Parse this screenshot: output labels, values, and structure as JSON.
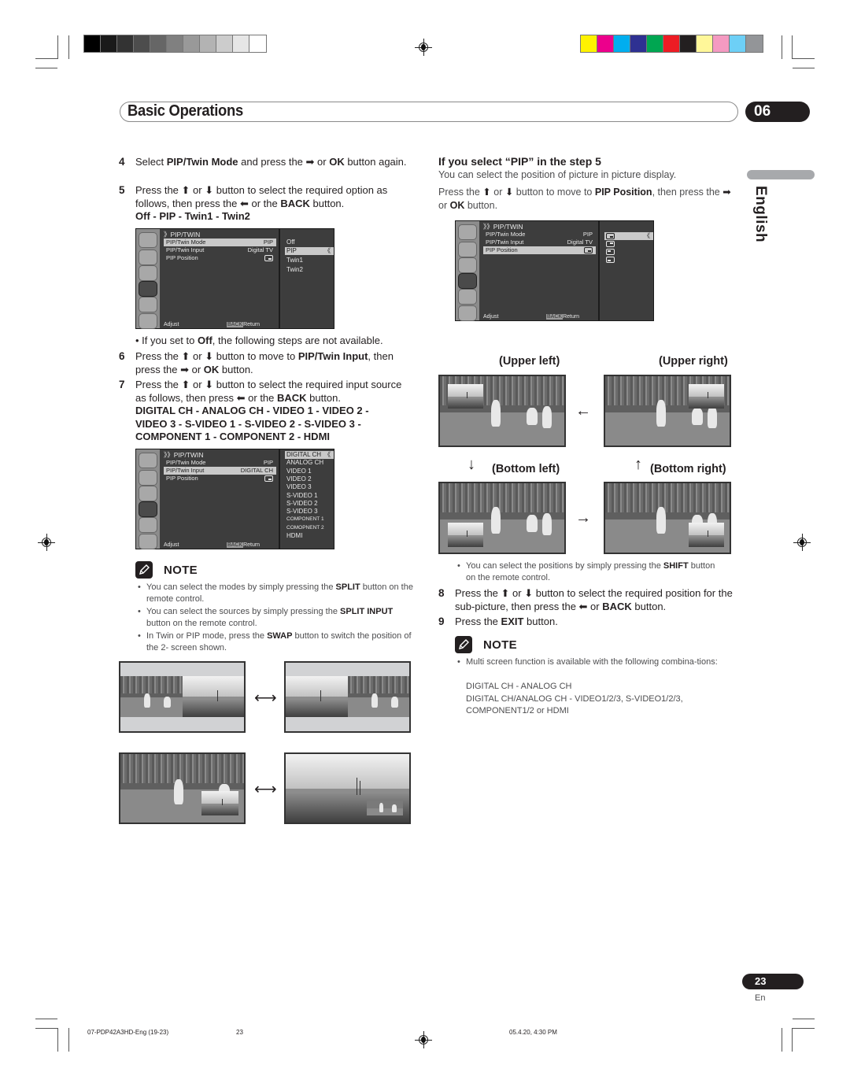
{
  "print_marks": {
    "grayscale_swatches": [
      "#000000",
      "#1a1a1a",
      "#333333",
      "#4d4d4d",
      "#666666",
      "#808080",
      "#999999",
      "#b3b3b3",
      "#cccccc",
      "#e6e6e6",
      "#ffffff"
    ],
    "color_swatches": [
      "#fff200",
      "#ec008c",
      "#00aeef",
      "#2e3192",
      "#00a651",
      "#ed1c24",
      "#231f20",
      "#fff799",
      "#f49ac1",
      "#6dcff6",
      "#939598"
    ]
  },
  "header": {
    "title": "Basic Operations",
    "chapter": "06"
  },
  "language_tab": "English",
  "left_column": {
    "step4": {
      "num": "4",
      "text_a": "Select ",
      "bold_a": "PIP/Twin Mode",
      "text_b": " and press the ",
      "arrow": "➡",
      "text_c": " or ",
      "bold_b": "OK",
      "text_d": " button again."
    },
    "step5": {
      "num": "5",
      "text_a": "Press the ",
      "up": "⬆",
      "or": " or ",
      "down": "⬇",
      "text_b": " button to select the required option as follows, then press the ",
      "left": "⬅",
      "text_c": " or the ",
      "bold_a": "BACK",
      "text_d": " button.",
      "options_line": "Off  - PIP - Twin1 - Twin2"
    },
    "menu1": {
      "title": "》PIP/TWIN",
      "rows": [
        {
          "label": "PIP/Twin Mode",
          "value": "PIP",
          "selected": true
        },
        {
          "label": "PIP/Twin Input",
          "value": "Digital TV",
          "selected": false
        },
        {
          "label": "PIP Position",
          "value": "",
          "selected": false
        }
      ],
      "options": [
        {
          "label": "Off",
          "selected": false
        },
        {
          "label": "PIP",
          "selected": true
        },
        {
          "label": "Twin1",
          "selected": false
        },
        {
          "label": "Twin2",
          "selected": false
        }
      ],
      "chevron": "《",
      "footer_adjust": "Adjust",
      "footer_back_key": "BACK",
      "footer_return": "Return"
    },
    "off_note": {
      "text_a": "If you set to ",
      "bold_a": "Off",
      "text_b": ", the following steps are not available."
    },
    "step6": {
      "num": "6",
      "text_a": "Press the ",
      "text_b": " button to move to ",
      "bold_a": "PIP/Twin Input",
      "text_c": ", then press the ",
      "text_d": " or ",
      "bold_b": "OK",
      "text_e": " button."
    },
    "step7": {
      "num": "7",
      "text_a": "Press the ",
      "text_b": " button to select the required input source as follows, then press ",
      "text_c": " or the ",
      "bold_a": "BACK",
      "text_d": " button.",
      "sources_line1": "DIGITAL CH - ANALOG CH - VIDEO 1 - VIDEO 2 -",
      "sources_line2": "VIDEO 3 - S-VIDEO 1 - S-VIDEO 2 - S-VIDEO 3 -",
      "sources_line3": "COMPONENT 1 - COMPONENT 2 - HDMI"
    },
    "menu2": {
      "title": "》》PIP/TWIN",
      "rows": [
        {
          "label": "PIP/Twin Mode",
          "value": "PIP",
          "selected": false
        },
        {
          "label": "PIP/Twin Input",
          "value": "DIGITAL CH",
          "selected": true
        },
        {
          "label": "PIP Position",
          "value": "",
          "selected": false
        }
      ],
      "options": [
        {
          "label": "DIGITAL CH",
          "selected": true
        },
        {
          "label": "ANALOG CH",
          "selected": false
        },
        {
          "label": "VIDEO 1",
          "selected": false
        },
        {
          "label": "VIDEO 2",
          "selected": false
        },
        {
          "label": "VIDEO 3",
          "selected": false
        },
        {
          "label": "S-VIDEO 1",
          "selected": false
        },
        {
          "label": "S-VIDEO 2",
          "selected": false
        },
        {
          "label": "S-VIDEO 3",
          "selected": false
        },
        {
          "label": "COMPONENT 1",
          "selected": false
        },
        {
          "label": "COMOPNENT 2",
          "selected": false
        },
        {
          "label": "HDMI",
          "selected": false
        }
      ],
      "chevron": "《",
      "footer_adjust": "Adjust",
      "footer_back_key": "BACK",
      "footer_return": "Return"
    },
    "note": {
      "label": "NOTE",
      "items": [
        {
          "text_a": "You can select the modes by simply pressing the ",
          "bold": "SPLIT",
          "text_b": " button on the remote control."
        },
        {
          "text_a": "You can select the sources by simply pressing the ",
          "bold": "SPLIT INPUT",
          "text_b": " button on the remote control."
        },
        {
          "text_a": "In Twin or PIP mode, press the ",
          "bold": "SWAP",
          "text_b": " button to switch the position of the 2- screen shown."
        }
      ]
    },
    "swap_arrow": "⟷"
  },
  "right_column": {
    "heading": "If you select “PIP” in the step 5",
    "intro": "You can select the position of picture in picture display.",
    "press": {
      "text_a": "Press the ",
      "text_b": " button to move to ",
      "bold_a": "PIP Position",
      "text_c": ", then press the ",
      "text_d": " or ",
      "bold_b": "OK",
      "text_e": " button."
    },
    "menu3": {
      "title": "》》PIP/TWIN",
      "rows": [
        {
          "label": "PIP/Twin Mode",
          "value": "PIP",
          "selected": false
        },
        {
          "label": "PIP/Twin Input",
          "value": "Digital TV",
          "selected": false
        },
        {
          "label": "PIP Position",
          "value": "",
          "selected": true
        }
      ],
      "options": [
        "bottom-right",
        "top-right",
        "top-left",
        "bottom-left"
      ],
      "selected_option": 0,
      "chevron": "《",
      "footer_adjust": "Adjust",
      "footer_back_key": "BACK",
      "footer_return": "Return"
    },
    "positions": {
      "upper_left": "(Upper left)",
      "upper_right": "(Upper right)",
      "bottom_left": "(Bottom left)",
      "bottom_right": "(Bottom right)"
    },
    "shift_note": {
      "text_a": "You can select the positions by simply pressing the ",
      "bold": "SHIFT",
      "text_b": " button on the remote control."
    },
    "step8": {
      "num": "8",
      "text_a": "Press the ",
      "text_b": " button to select the required position for the sub-picture, then press the ",
      "text_c": " or ",
      "bold_a": "BACK",
      "text_d": " button."
    },
    "step9": {
      "num": "9",
      "text_a": "Press the ",
      "bold_a": "EXIT",
      "text_b": " button."
    },
    "note": {
      "label": "NOTE",
      "item": "Multi screen function is available with the following combina-tions:",
      "combo1": "DIGITAL CH - ANALOG CH",
      "combo2": "DIGITAL CH/ANALOG CH - VIDEO1/2/3, S-VIDEO1/2/3,",
      "combo3": "COMPONENT1/2 or HDMI"
    }
  },
  "page": {
    "number": "23",
    "lang_code": "En"
  },
  "slug": {
    "file": "07-PDP42A3HD-Eng (19-23)",
    "page": "23",
    "date": "05.4.20, 4:30 PM"
  }
}
